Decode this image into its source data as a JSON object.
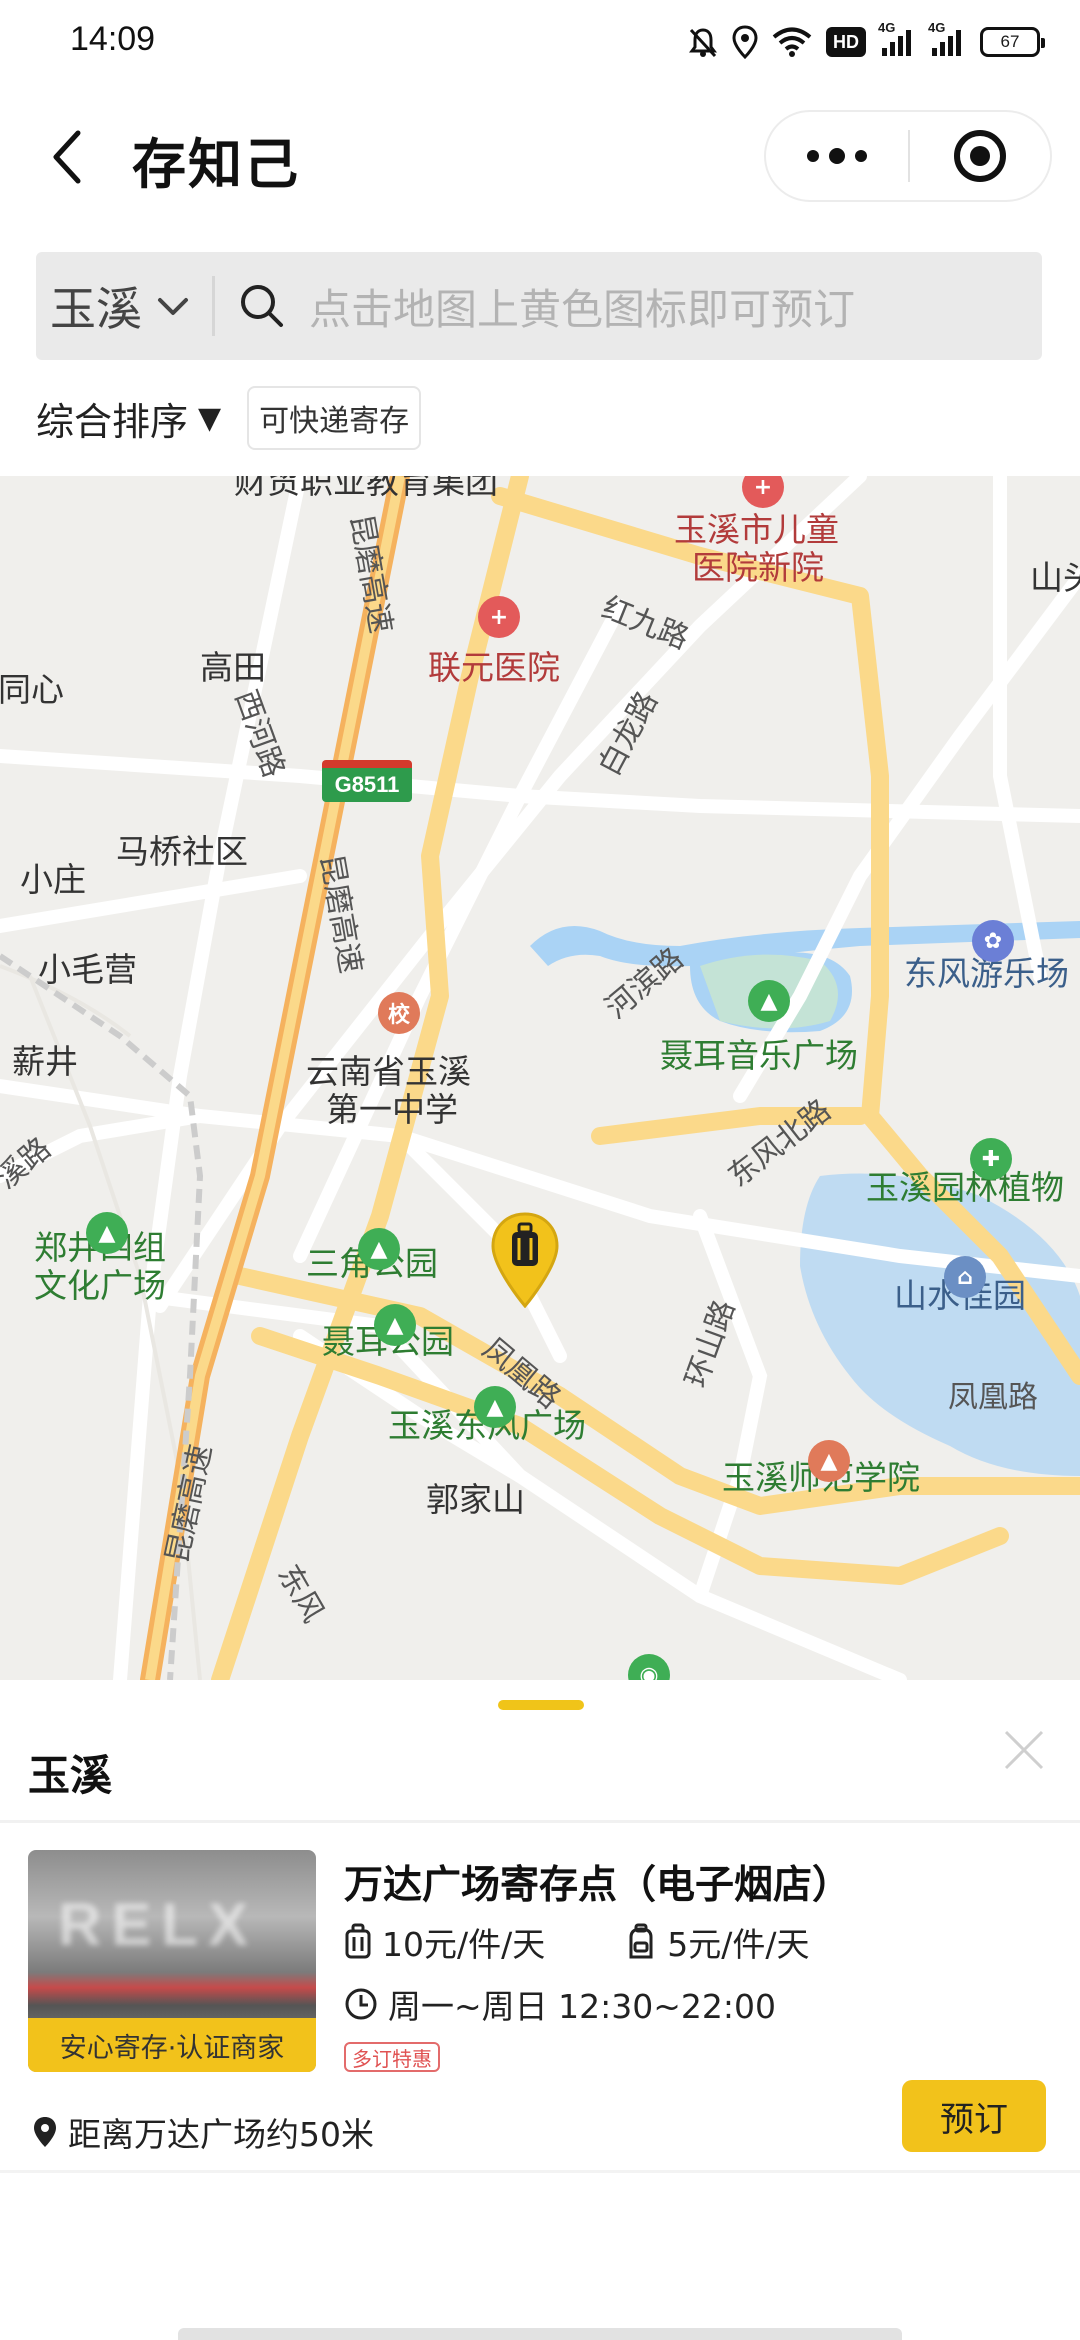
{
  "status_bar": {
    "time": "14:09",
    "hd_label": "HD",
    "net1_label": "4G",
    "net2_label": "4G",
    "battery": "67",
    "icons": [
      "bell-off-icon",
      "location-icon",
      "wifi-icon",
      "hd-icon",
      "signal-icon",
      "signal-icon",
      "battery-icon"
    ]
  },
  "nav": {
    "title": "存知己",
    "back_icon": "chevron-left-icon",
    "more_icon": "more-dots-icon",
    "close_icon": "target-icon"
  },
  "search": {
    "city": "玉溪",
    "placeholder": "点击地图上黄色图标即可预订"
  },
  "filters": {
    "sort_label": "综合排序",
    "sort_arrow": "▼",
    "chip_label": "可快递寄存"
  },
  "map": {
    "highway_badge": "G8511",
    "labels": {
      "edu_group": "财贸职业教育集团",
      "children_hospital_l1": "玉溪市儿童",
      "children_hospital_l2": "医院新院",
      "shan": "山头",
      "hong_jiu": "红九路",
      "lianyuan": "联元医院",
      "gaotian": "高田",
      "xin": "同心",
      "xihe": "西河路",
      "bailong": "白龙路",
      "kunmo1": "昆磨高速",
      "maqiao": "马桥社区",
      "xiaozhuang": "小庄",
      "kunmo2": "昆磨高速",
      "xiaomaoying": "小毛营",
      "dongfeng_park": "东风游乐场",
      "xinjing": "薪井",
      "hebin": "河滨路",
      "nie_er_music": "聂耳音乐广场",
      "school_l1": "云南省玉溪",
      "school_l2": "第一中学",
      "xi_road": "溪路",
      "dongfeng_north": "东风北路",
      "yuxi_garden": "玉溪园林植物",
      "zhengjing_l1": "郑井四组",
      "zhengjing_l2": "文化广场",
      "sanjiao": "三角公园",
      "shanshui": "山水佳园",
      "huan_shan": "环山路",
      "fenghuang1": "凤凰路",
      "nie_er_park": "聂耳公园",
      "fenghuang2": "凤凰路",
      "kunmo3": "昆磨高速",
      "dongfeng_square": "玉溪东风广场",
      "normal_univ": "玉溪师范学院",
      "guojiashan": "郭家山",
      "dongfeng_road": "东风"
    }
  },
  "sheet": {
    "title": "玉溪",
    "store": {
      "name": "万达广场寄存点（电子烟店）",
      "thumb_text": "RELX",
      "thumb_badge": "安心寄存·认证商家",
      "price_luggage": "10元/件/天",
      "price_bag": "5元/件/天",
      "hours": "周一~周日 12:30~22:00",
      "promo": "多订特惠",
      "distance": "距离万达广场约50米",
      "book_label": "预订"
    }
  },
  "colors": {
    "accent": "#f2c21b",
    "map_bg": "#f0efec",
    "road_major": "#fbd98a",
    "road_minor": "#ffffff",
    "water": "#aad3f5",
    "green": "#2e7d32"
  }
}
